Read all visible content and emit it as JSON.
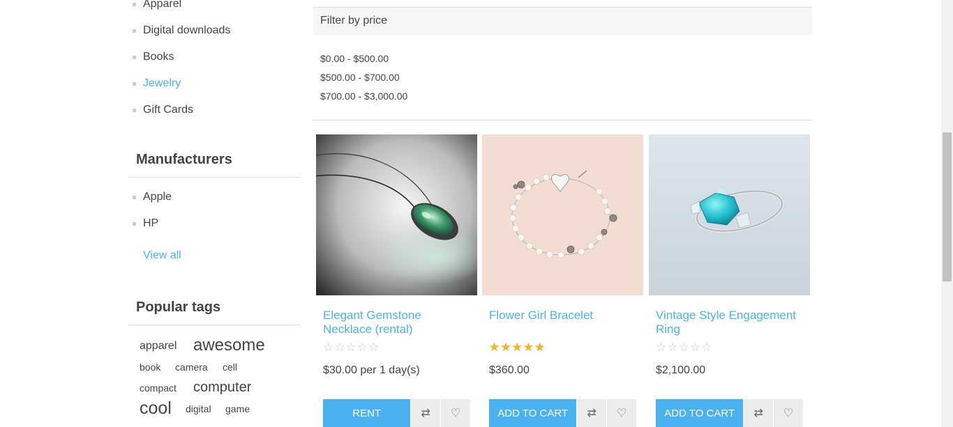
{
  "categories": [
    "Apparel",
    "Digital downloads",
    "Books",
    "Jewelry",
    "Gift Cards"
  ],
  "active_category": "Jewelry",
  "manufacturers": {
    "title": "Manufacturers",
    "items": [
      "Apple",
      "HP"
    ],
    "view_all": "View all"
  },
  "popular_tags": {
    "title": "Popular tags",
    "tags": [
      "apparel",
      "awesome",
      "book",
      "camera",
      "cell",
      "compact",
      "computer",
      "cool",
      "digital",
      "game"
    ]
  },
  "filter": {
    "title": "Filter by price",
    "ranges": [
      "$0.00 - $500.00",
      "$500.00 - $700.00",
      "$700.00 - $3,000.00"
    ]
  },
  "products": [
    {
      "title": "Elegant Gemstone Necklace (rental)",
      "rating": 0,
      "price": "$30.00 per 1 day(s)",
      "button": "Rent"
    },
    {
      "title": "Flower Girl Bracelet",
      "rating": 5,
      "price": "$360.00",
      "button": "Add to cart"
    },
    {
      "title": "Vintage Style Engagement Ring",
      "rating": 0,
      "price": "$2,100.00",
      "button": "Add to cart"
    }
  ],
  "icons": {
    "compare": "compare-icon",
    "wishlist": "heart-icon"
  },
  "colors": {
    "accent": "#4ab2f1",
    "star": "#f2b623"
  }
}
